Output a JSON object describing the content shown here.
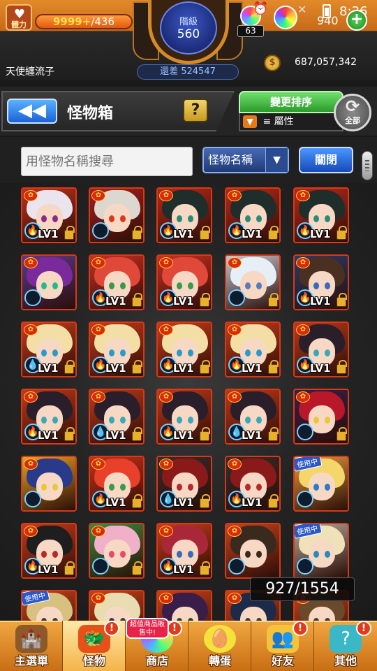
{
  "status": {
    "stamina_label": "體力",
    "stamina_current": "9999+",
    "stamina_max": "/436",
    "gem_count": "63",
    "coin_count": "940",
    "clock": "8:36"
  },
  "rank": {
    "label": "階級",
    "value": "560",
    "exp_text": "還差 524547"
  },
  "player": {
    "name": "天使纏流子",
    "gold": "687,057,342"
  },
  "header": {
    "title": "怪物箱",
    "help_label": "?",
    "sort_label": "變更排序",
    "filter_label": "屬性",
    "all_label": "全部"
  },
  "search": {
    "placeholder": "用怪物名稱搜尋",
    "value": "",
    "select_value": "怪物名稱",
    "close_label": "關閉"
  },
  "box_count": "927/1554",
  "cards": [
    {
      "hair": "#e9e4ee",
      "bg": "#c03018",
      "eye": "#8a2a8a",
      "elem": "🔥",
      "level": "LV1",
      "lock": true
    },
    {
      "hair": "#dcd8cf",
      "bg": "#a8201c",
      "eye": "#d83a1a",
      "elem": "",
      "level": "",
      "lock": true
    },
    {
      "hair": "#1f2e2a",
      "bg": "#b82818",
      "eye": "#2a8a7a",
      "elem": "🔥",
      "level": "LV1",
      "lock": true
    },
    {
      "hair": "#1f2e2a",
      "bg": "#b82818",
      "eye": "#2a8a7a",
      "elem": "🔥",
      "level": "LV1",
      "lock": true
    },
    {
      "hair": "#1f2e2a",
      "bg": "#b82818",
      "eye": "#2a8a7a",
      "elem": "🔥",
      "level": "LV1",
      "lock": true
    },
    {
      "hair": "#7a2a9a",
      "bg": "#5a3a8a",
      "eye": "#2ab88a",
      "elem": "",
      "level": "",
      "lock": false
    },
    {
      "hair": "#e0483a",
      "bg": "#c83020",
      "eye": "#3a9a4a",
      "elem": "🔥",
      "level": "LV1",
      "lock": true
    },
    {
      "hair": "#e0483a",
      "bg": "#c83020",
      "eye": "#3a9a4a",
      "elem": "🔥",
      "level": "LV1",
      "lock": true
    },
    {
      "hair": "#e6eef6",
      "bg": "#c8c4d0",
      "eye": "#5a7ab8",
      "elem": "",
      "level": "",
      "lock": true
    },
    {
      "hair": "#4a3020",
      "bg": "#2a3a6a",
      "eye": "#3a6ab8",
      "elem": "🔥",
      "level": "LV1",
      "lock": true
    },
    {
      "hair": "#f3dfa6",
      "bg": "#c83a18",
      "eye": "#2a9ac8",
      "elem": "💧",
      "level": "LV1",
      "lock": true
    },
    {
      "hair": "#f3dfa6",
      "bg": "#c83a18",
      "eye": "#2a9ac8",
      "elem": "🔥",
      "level": "LV1",
      "lock": true
    },
    {
      "hair": "#f3dfa6",
      "bg": "#c83a18",
      "eye": "#2a9ac8",
      "elem": "🔥",
      "level": "LV1",
      "lock": true
    },
    {
      "hair": "#f3dfa6",
      "bg": "#c83a18",
      "eye": "#2a9ac8",
      "elem": "🔥",
      "level": "LV1",
      "lock": true
    },
    {
      "hair": "#2a1e2a",
      "bg": "#b83a18",
      "eye": "#3aa8b8",
      "elem": "🔥",
      "level": "LV1",
      "lock": true
    },
    {
      "hair": "#2a1e2a",
      "bg": "#c03818",
      "eye": "#3aa8b8",
      "elem": "🔥",
      "level": "LV1",
      "lock": true
    },
    {
      "hair": "#2a1e2a",
      "bg": "#c03818",
      "eye": "#3aa8b8",
      "elem": "💧",
      "level": "LV1",
      "lock": true
    },
    {
      "hair": "#2a1e2a",
      "bg": "#c03818",
      "eye": "#3aa8b8",
      "elem": "🔥",
      "level": "LV1",
      "lock": true
    },
    {
      "hair": "#2a1e2a",
      "bg": "#c03818",
      "eye": "#3aa8b8",
      "elem": "💧",
      "level": "LV1",
      "lock": true
    },
    {
      "hair": "#b8182a",
      "bg": "#3a1e48",
      "eye": "#e8c83a",
      "elem": "",
      "level": "",
      "lock": true
    },
    {
      "hair": "#2a3a8a",
      "bg": "#e8a020",
      "eye": "#e8c83a",
      "elem": "",
      "level": "",
      "lock": false
    },
    {
      "hair": "#e8402a",
      "bg": "#c83018",
      "eye": "#3a9a4a",
      "elem": "🔥",
      "level": "LV1",
      "lock": true
    },
    {
      "hair": "#8a1a1a",
      "bg": "#3a2a2a",
      "eye": "#b82a2a",
      "elem": "💧",
      "level": "LV1",
      "lock": true
    },
    {
      "hair": "#8a1a1a",
      "bg": "#3a2a2a",
      "eye": "#b82a2a",
      "elem": "🔥",
      "level": "LV1",
      "lock": true
    },
    {
      "hair": "#f5d66a",
      "bg": "#e89a3a",
      "eye": "#2a7ac8",
      "elem": "",
      "level": "",
      "lock": false
    },
    {
      "hair": "#1e1e1e",
      "bg": "#c83a18",
      "eye": "#b82a2a",
      "elem": "🔥",
      "level": "LV1",
      "lock": true
    },
    {
      "hair": "#f0b0c8",
      "bg": "#3a8a3a",
      "eye": "#e84a6a",
      "elem": "",
      "level": "",
      "lock": true
    },
    {
      "hair": "#a8283a",
      "bg": "#c83a18",
      "eye": "#3a6ab8",
      "elem": "🔥",
      "level": "LV1",
      "lock": true
    },
    {
      "hair": "#3a2a1e",
      "bg": "#c8401a",
      "eye": "#3a2a1e",
      "elem": "",
      "level": "",
      "lock": false
    },
    {
      "hair": "#efe2b8",
      "bg": "#b8a89a",
      "eye": "#2a8ab8",
      "elem": "",
      "level": "",
      "lock": false
    },
    {
      "hair": "#d8c080",
      "bg": "#c84018",
      "eye": "#3a3a3a",
      "elem": "",
      "level": "",
      "lock": false
    },
    {
      "hair": "#e8dcb0",
      "bg": "#c84018",
      "eye": "#3a3a3a",
      "elem": "",
      "level": "",
      "lock": false
    },
    {
      "hair": "#3a1e4a",
      "bg": "#c84018",
      "eye": "#3a3a3a",
      "elem": "",
      "level": "",
      "lock": false
    },
    {
      "hair": "#1e2a4a",
      "bg": "#c84018",
      "eye": "#3a3a3a",
      "elem": "",
      "level": "",
      "lock": false
    },
    {
      "hair": "#6a4a2a",
      "bg": "#c84018",
      "eye": "#3a3a3a",
      "elem": "",
      "level": "",
      "lock": false
    }
  ],
  "in_use_label": "使用中",
  "nav": {
    "main_label": "主選單",
    "monster_label": "怪物",
    "shop_label": "商店",
    "gacha_label": "轉蛋",
    "friends_label": "好友",
    "other_label": "其他",
    "sale_tag": "超值商品販售中!",
    "alert_mark": "!"
  }
}
